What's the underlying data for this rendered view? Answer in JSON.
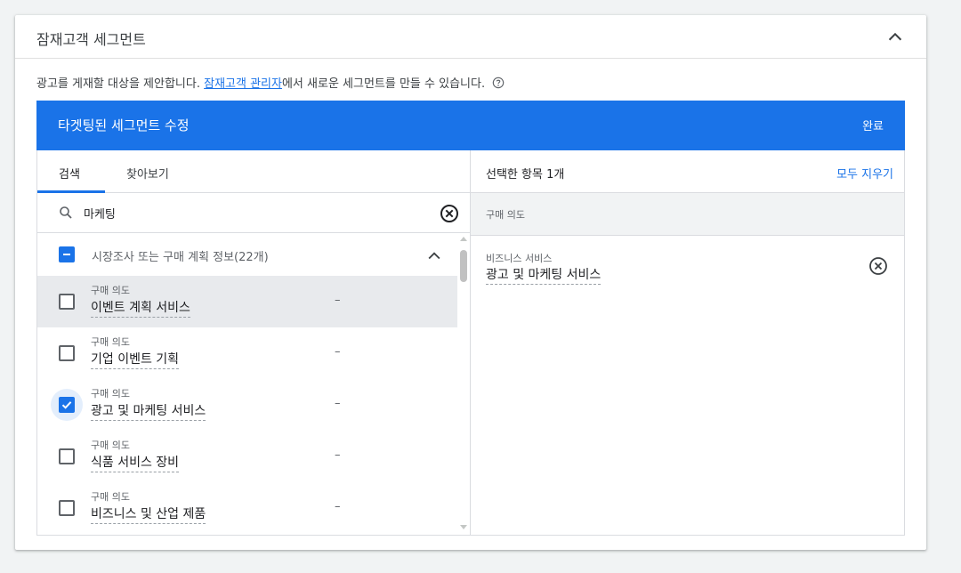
{
  "card": {
    "title": "잠재고객 세그먼트"
  },
  "description": {
    "before_link": "광고를 게재할 대상을 제안합니다. ",
    "link": "잠재고객 관리자",
    "after_link": "에서 새로운 세그먼트를 만들 수 있습니다."
  },
  "editor": {
    "title": "타겟팅된 세그먼트 수정",
    "done_label": "완료"
  },
  "tabs": [
    {
      "label": "검색",
      "active": true
    },
    {
      "label": "찾아보기",
      "active": false
    }
  ],
  "search": {
    "value": "마케팅",
    "placeholder": ""
  },
  "group": {
    "label": "시장조사 또는 구매 계획 정보(22개)",
    "state": "indeterminate"
  },
  "items": [
    {
      "category": "구매 의도",
      "name": "이벤트 계획 서비스",
      "dash": "–",
      "checked": false
    },
    {
      "category": "구매 의도",
      "name": "기업 이벤트 기획",
      "dash": "–",
      "checked": false
    },
    {
      "category": "구매 의도",
      "name": "광고 및 마케팅 서비스",
      "dash": "–",
      "checked": true
    },
    {
      "category": "구매 의도",
      "name": "식품 서비스 장비",
      "dash": "–",
      "checked": false
    },
    {
      "category": "구매 의도",
      "name": "비즈니스 및 산업 제품",
      "dash": "–",
      "checked": false
    }
  ],
  "selected": {
    "count_label": "선택한 항목 1개",
    "clear_all_label": "모두 지우기",
    "group_label": "구매 의도",
    "items": [
      {
        "category": "비즈니스 서비스",
        "name": "광고 및 마케팅 서비스"
      }
    ]
  },
  "colors": {
    "accent": "#1a73e8",
    "hover_row": "#e8eaed",
    "text": "#202124",
    "muted": "#5f6368"
  }
}
